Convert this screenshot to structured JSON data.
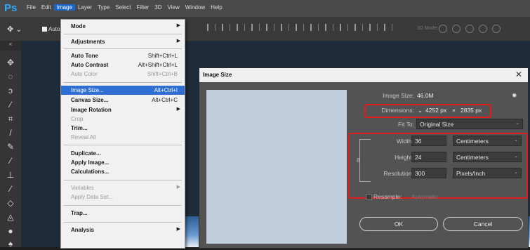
{
  "app": {
    "logo": "Ps"
  },
  "menubar": {
    "items": [
      "File",
      "Edit",
      "Image",
      "Layer",
      "Type",
      "Select",
      "Filter",
      "3D",
      "View",
      "Window",
      "Help"
    ],
    "active": "Image"
  },
  "options_bar": {
    "auto_label": "Auto",
    "three_d_label": "3D Mode:"
  },
  "tabs": {
    "collapse": "«"
  },
  "image_menu": {
    "mode": "Mode",
    "adjustments": "Adjustments",
    "auto_tone": {
      "label": "Auto Tone",
      "shortcut": "Shift+Ctrl+L"
    },
    "auto_contrast": {
      "label": "Auto Contrast",
      "shortcut": "Alt+Shift+Ctrl+L"
    },
    "auto_color": {
      "label": "Auto Color",
      "shortcut": "Shift+Ctrl+B"
    },
    "image_size": {
      "label": "Image Size...",
      "shortcut": "Alt+Ctrl+I"
    },
    "canvas_size": {
      "label": "Canvas Size...",
      "shortcut": "Alt+Ctrl+C"
    },
    "image_rotation": "Image Rotation",
    "crop": "Crop",
    "trim": "Trim...",
    "reveal_all": "Reveal All",
    "duplicate": "Duplicate...",
    "apply_image": "Apply Image...",
    "calculations": "Calculations...",
    "variables": "Variables",
    "apply_data_set": "Apply Data Set...",
    "trap": "Trap...",
    "analysis": "Analysis"
  },
  "dialog": {
    "title": "Image Size",
    "image_size_label": "Image Size:",
    "image_size_value": "46.0M",
    "dimensions_label": "Dimensions:",
    "dim_width": "4252 px",
    "dim_x": "×",
    "dim_height": "2835 px",
    "fit_to_label": "Fit To:",
    "fit_to_value": "Original Size",
    "width_label": "Width:",
    "width_value": "36",
    "width_unit": "Centimeters",
    "height_label": "Height:",
    "height_value": "24",
    "height_unit": "Centimeters",
    "resolution_label": "Resolution:",
    "resolution_value": "300",
    "resolution_unit": "Pixels/Inch",
    "resample_label": "Resample:",
    "resample_value": "Automatic",
    "ok": "OK",
    "cancel": "Cancel"
  },
  "colors": {
    "highlight": "#2f6fd4",
    "annotation": "#e21c1c",
    "ps_blue": "#31a8ff"
  }
}
